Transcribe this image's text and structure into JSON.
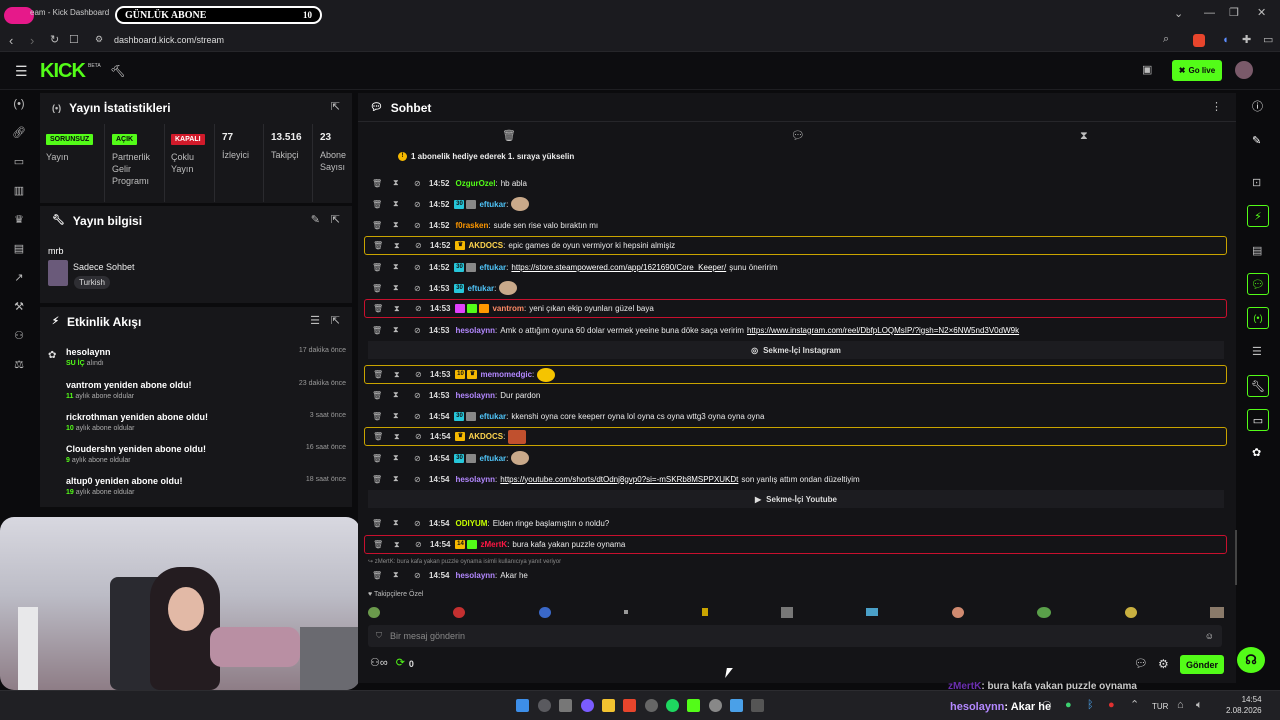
{
  "browser": {
    "tab_title": "eam - Kick Dashboard",
    "overlay_label": "GÜNLÜK ABONE",
    "overlay_count": "10",
    "url": "dashboard.kick.com/stream"
  },
  "topnav": {
    "logo": "KICK",
    "logo_beta": "BETA",
    "go_live": "Go live"
  },
  "stats": {
    "title": "Yayın İstatistikleri",
    "items": [
      {
        "badge": "SORUNSUZ",
        "badge_color": "#53fc18",
        "label": "Yayın"
      },
      {
        "badge": "AÇIK",
        "badge_color": "#53fc18",
        "label": "Partnerlik Gelir Programı"
      },
      {
        "badge": "KAPALI",
        "badge_color": "#d11a2a",
        "label": "Çoklu Yayın"
      },
      {
        "value": "77",
        "label": "İzleyici"
      },
      {
        "value": "13.516",
        "label": "Takipçi"
      },
      {
        "value": "23",
        "label": "Abone Sayısı"
      }
    ]
  },
  "info": {
    "title": "Yayın bilgisi",
    "stream_title": "mrb",
    "category": "Sadece Sohbet",
    "tag": "Turkish"
  },
  "feed": {
    "title": "Etkinlik Akışı",
    "events": [
      {
        "title": "hesolaynn",
        "sub_highlight": "SU İÇ",
        "sub": " alındı",
        "ago": "17 dakika önce"
      },
      {
        "title": "vantrom yeniden abone oldu!",
        "sub_highlight": "11",
        "sub": " aylık abone oldular",
        "ago": "23 dakika önce"
      },
      {
        "title": "rickrothman yeniden abone oldu!",
        "sub_highlight": "10",
        "sub": " aylık abone oldular",
        "ago": "3 saat önce"
      },
      {
        "title": "Cloudershn yeniden abone oldu!",
        "sub_highlight": "9",
        "sub": " aylık abone oldular",
        "ago": "16 saat önce"
      },
      {
        "title": "altup0 yeniden abone oldu!",
        "sub_highlight": "19",
        "sub": " aylık abone oldular",
        "ago": "18 saat önce"
      }
    ]
  },
  "chat": {
    "title": "Sohbet",
    "pinned": "1 abonelik hediye ederek 1. sıraya yükselin",
    "messages": [
      {
        "time": "14:52",
        "user": "OzgurOzel",
        "color": "#53fc18",
        "text": "hb abla"
      },
      {
        "time": "14:52",
        "user": "eftukar",
        "color": "#4fc3f7",
        "badge": "30",
        "text": "",
        "emote": true
      },
      {
        "time": "14:52",
        "user": "f0rasken",
        "color": "#ff9800",
        "text": "sude sen rise valo bıraktın mı"
      },
      {
        "time": "14:52",
        "user": "AKDOCS",
        "color": "#ffd54f",
        "text": "epic games de oyun vermiyor ki hepsini almişiz",
        "style": "hl"
      },
      {
        "time": "14:52",
        "user": "eftukar",
        "color": "#4fc3f7",
        "badge": "30",
        "link": "https://store.steampowered.com/app/1621690/Core_Keeper/",
        "text": "şunu öneririm"
      },
      {
        "time": "14:53",
        "user": "eftukar",
        "color": "#4fc3f7",
        "badge": "30",
        "text": "",
        "emote": true
      },
      {
        "time": "14:53",
        "user": "vantrom",
        "color": "#ff8a65",
        "text": "yeni çıkan ekip oyunları güzel baya",
        "style": "hr"
      },
      {
        "time": "14:53",
        "user": "hesolaynn",
        "color": "#b388ff",
        "text": "Amk o attığım oyuna 60 dolar vermek yeeine buna döke saça veririm",
        "link": "https://www.instagram.com/reel/DbfpLOQMsIP/?igsh=N2×6NW5nd3V0dW9k"
      },
      {
        "time": "14:53",
        "user": "memomedgic",
        "color": "#b388ff",
        "badge": "10",
        "text": "",
        "style": "hl",
        "emote": true
      },
      {
        "time": "14:53",
        "user": "hesolaynn",
        "color": "#b388ff",
        "text": "Dur pardon"
      },
      {
        "time": "14:54",
        "user": "eftukar",
        "color": "#4fc3f7",
        "badge": "30",
        "text": "kkenshi oyna core keeperr oyna lol oyna cs oyna wttg3 oyna oyna oyna"
      },
      {
        "time": "14:54",
        "user": "AKDOCS",
        "color": "#ffd54f",
        "text": "",
        "style": "hl",
        "emote": true
      },
      {
        "time": "14:54",
        "user": "eftukar",
        "color": "#4fc3f7",
        "badge": "30",
        "text": "",
        "emote": true
      },
      {
        "time": "14:54",
        "user": "hesolaynn",
        "color": "#b388ff",
        "link": "https://youtube.com/shorts/dtOdnj8gvp0?si=-mSKRb8MSPPXUKDt",
        "text": "son yanlış attım ondan düzeltiyim"
      },
      {
        "time": "14:54",
        "user": "ODIYUM",
        "color": "#c6ff00",
        "text": "Elden ringe başlamıştın o noldu?"
      },
      {
        "time": "14:54",
        "user": "zMertK",
        "color": "#ff1744",
        "badge": "14",
        "text": "bura kafa yakan puzzle oynama",
        "style": "hr"
      },
      {
        "time": "14:54",
        "user": "hesolaynn",
        "color": "#b388ff",
        "text": "Akar he"
      }
    ],
    "sekme_instagram": "Sekme-İçi Instagram",
    "sekme_youtube": "Sekme-İçi Youtube",
    "reply_info": "zMertK: bura kafa yakan puzzle oynama isimli kullanıcıya yanıt veriyor",
    "followers_only": "Takipçilere Özel",
    "input_placeholder": "Bir mesaj gönderin",
    "points": "0",
    "send": "Gönder"
  },
  "overlay": {
    "chat_user1": "zMertK",
    "chat_text1": ": bura kafa yakan puzzle oynama",
    "chat_user2": "hesolaynn",
    "chat_text2": ": Akar he"
  },
  "taskbar": {
    "lang": "TUR",
    "time": "14:54",
    "date": "2.08.2026"
  },
  "colors": {
    "accent": "#53fc18",
    "panel": "#17171a"
  }
}
